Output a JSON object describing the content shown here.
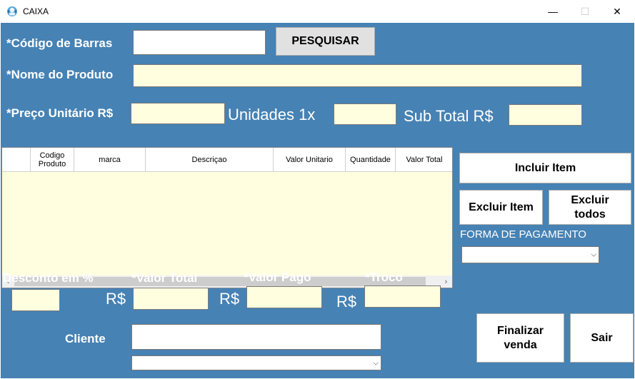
{
  "window": {
    "title": "CAIXA",
    "minimize": "—",
    "maximize": "☐",
    "close": "✕"
  },
  "labels": {
    "codigo_barras": "*Código de Barras",
    "nome_produto": "*Nome do Produto",
    "preco_unitario": "*Preço Unitário R$",
    "unidades": "Unidades 1x",
    "sub_total": "Sub Total R$",
    "desconto": "Desconto em %",
    "valor_total": "*Valor Total",
    "valor_pago": "*Valor Pago",
    "troco": "*Troco",
    "rs1": "R$",
    "rs2": "R$",
    "rs3": "R$",
    "forma_pagamento": "FORMA DE PAGAMENTO",
    "cliente": "Cliente"
  },
  "buttons": {
    "pesquisar": "PESQUISAR",
    "incluir_item": "Incluir Item",
    "excluir_item": "Excluir Item",
    "excluir_todos": "Excluir todos",
    "finalizar_venda": "Finalizar venda",
    "sair": "Sair"
  },
  "fields": {
    "codigo_barras": "",
    "nome_produto": "",
    "preco_unitario": "",
    "unidades": "",
    "sub_total": "",
    "desconto": "",
    "valor_total": "",
    "valor_pago": "",
    "troco": "",
    "cliente": ""
  },
  "combos": {
    "forma_pagamento": "",
    "cliente": ""
  },
  "grid": {
    "columns": [
      "",
      "Codigo Produto",
      "marca",
      "Descriçao",
      "Valor Unitario",
      "Quantidade",
      "Valor Total"
    ],
    "rows": []
  },
  "scroll": {
    "left": "‹",
    "right": "›"
  },
  "colors": {
    "background": "#4682b4",
    "input_yellow": "#ffffe0",
    "button_grey": "#e1e1e1"
  }
}
